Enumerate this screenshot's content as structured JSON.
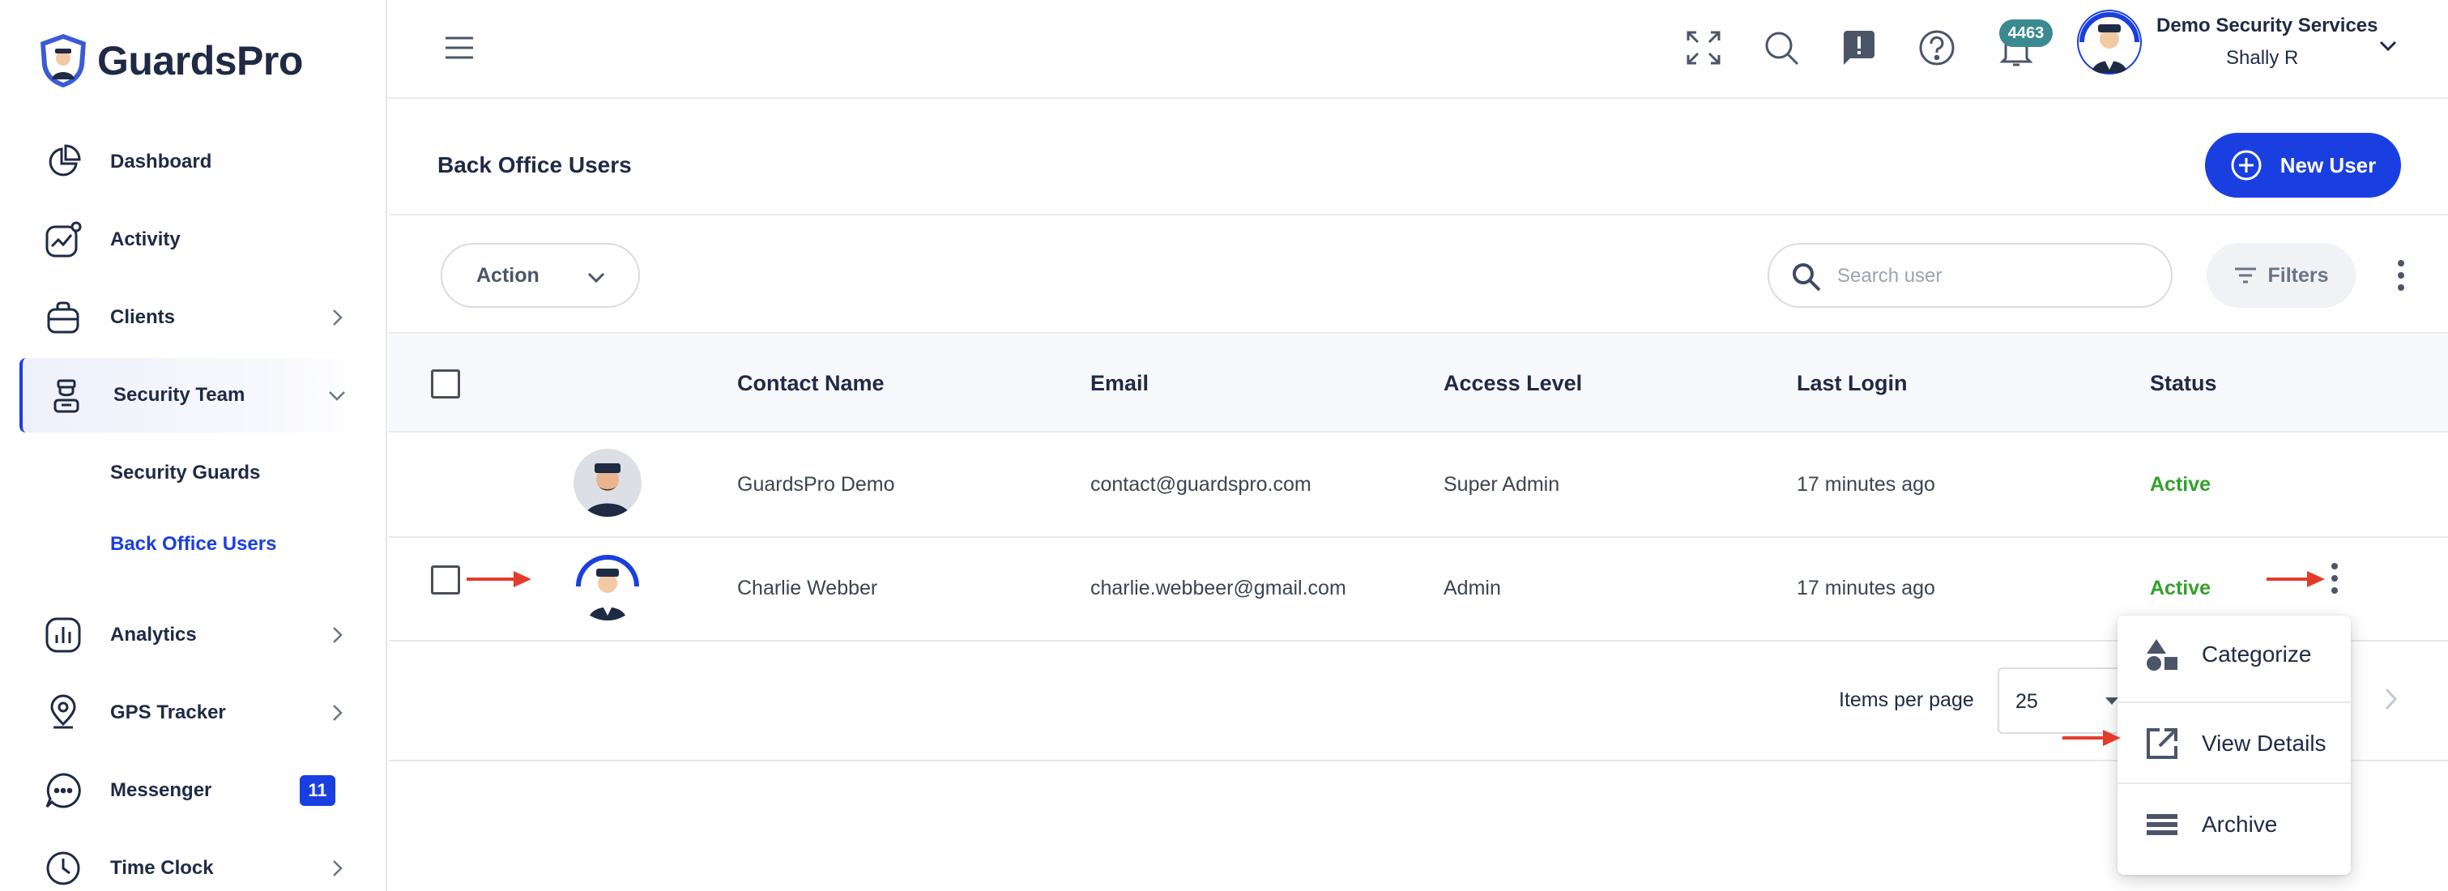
{
  "app": {
    "logo_text": "GuardsPro"
  },
  "sidebar": {
    "items": [
      {
        "label": "Dashboard",
        "icon": "pie-chart-icon"
      },
      {
        "label": "Activity",
        "icon": "activity-chart-icon"
      },
      {
        "label": "Clients",
        "icon": "briefcase-icon"
      },
      {
        "label": "Security Team",
        "icon": "guard-icon"
      },
      {
        "label": "Analytics",
        "icon": "analytics-icon"
      },
      {
        "label": "GPS Tracker",
        "icon": "location-pin-icon"
      },
      {
        "label": "Messenger",
        "icon": "chat-bubble-icon",
        "badge": "11"
      },
      {
        "label": "Time Clock",
        "icon": "clock-icon"
      }
    ],
    "sub_items": [
      {
        "label": "Security Guards"
      },
      {
        "label": "Back Office Users"
      }
    ],
    "active_item": "Security Team",
    "active_sub_item": "Back Office Users"
  },
  "topbar": {
    "notification_count": "4463",
    "company_name": "Demo Security Services",
    "user_name": "Shally R"
  },
  "page": {
    "title": "Back Office Users",
    "new_user_label": "New User"
  },
  "toolbar": {
    "action_label": "Action",
    "search_placeholder": "Search user",
    "filters_label": "Filters"
  },
  "table": {
    "columns": [
      "Contact Name",
      "Email",
      "Access Level",
      "Last Login",
      "Status"
    ],
    "rows": [
      {
        "name": "GuardsPro Demo",
        "email": "contact@guardspro.com",
        "access": "Super Admin",
        "last_login": "17 minutes ago",
        "status": "Active"
      },
      {
        "name": "Charlie Webber",
        "email": "charlie.webbeer@gmail.com",
        "access": "Admin",
        "last_login": "17 minutes ago",
        "status": "Active"
      }
    ]
  },
  "pagination": {
    "items_per_page_label": "Items per page",
    "items_per_page_value": "25"
  },
  "context_menu": {
    "items": [
      {
        "label": "Categorize",
        "icon": "shapes-icon"
      },
      {
        "label": "View Details",
        "icon": "open-external-icon"
      },
      {
        "label": "Archive",
        "icon": "archive-icon"
      }
    ]
  },
  "colors": {
    "accent": "#1a3fe0",
    "status_active": "#33a02c",
    "annotation_arrow": "#e53b2c"
  }
}
